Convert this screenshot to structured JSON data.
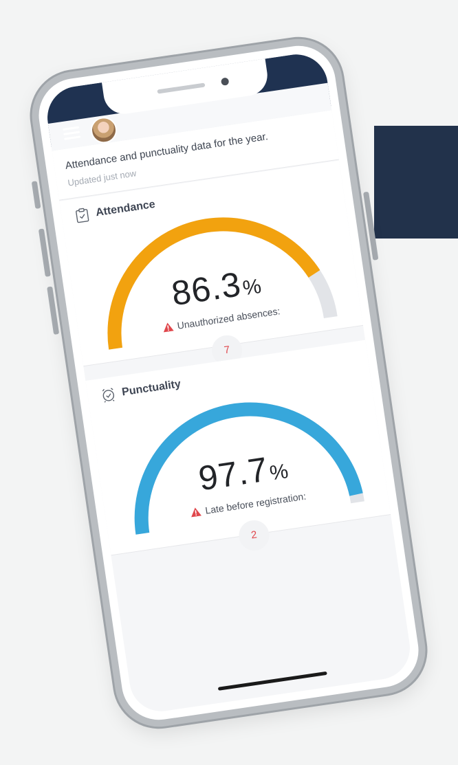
{
  "header": {
    "subtitle": "Attendance and punctuality data for the year.",
    "updated": "Updated just now"
  },
  "attendance": {
    "title": "Attendance",
    "value": "86.3",
    "unit": "%",
    "fraction": 0.863,
    "warning_label": "Unauthorized absences:",
    "count": "7",
    "color": "#f2a20f"
  },
  "punctuality": {
    "title": "Punctuality",
    "value": "97.7",
    "unit": "%",
    "fraction": 0.977,
    "warning_label": "Late before registration:",
    "count": "2",
    "color": "#37a7db"
  },
  "colors": {
    "nav_bar": "#1f3251",
    "background_block": "#22324b",
    "track": "#e2e4e8",
    "warning": "#e0474c"
  },
  "icons": {
    "menu": "hamburger-menu-icon",
    "attendance": "clipboard-check-icon",
    "punctuality": "alarm-clock-check-icon",
    "warning": "warning-triangle-icon"
  }
}
